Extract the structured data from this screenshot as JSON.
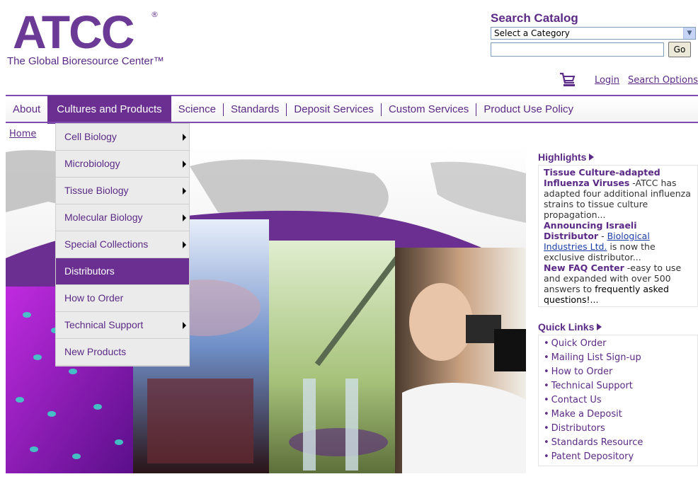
{
  "logo": {
    "mark": "ATCC",
    "reg": "®",
    "tagline": "The Global Bioresource Center™"
  },
  "search": {
    "title": "Search Catalog",
    "category_selected": "Select a Category",
    "input_value": "",
    "go_label": "Go"
  },
  "user_links": {
    "login": "Login",
    "search_options": "Search Options"
  },
  "nav": {
    "items": [
      "About",
      "Cultures and Products",
      "Science",
      "Standards",
      "Deposit Services",
      "Custom Services",
      "Product Use Policy"
    ]
  },
  "breadcrumb": {
    "home": "Home"
  },
  "dropdown": {
    "items": [
      {
        "label": "Cell Biology"
      },
      {
        "label": "Microbiology"
      },
      {
        "label": "Tissue Biology"
      },
      {
        "label": "Molecular Biology"
      },
      {
        "label": "Special Collections"
      },
      {
        "label": "Distributors"
      },
      {
        "label": "How to Order"
      },
      {
        "label": "Technical Support"
      },
      {
        "label": "New Products"
      }
    ]
  },
  "highlights": {
    "title": "Highlights",
    "item1_title": "Tissue Culture-adapted Influenza Viruses",
    "item1_text": " -ATCC has adapted four additional influenza strains to tissue culture propagation...",
    "item2_title": "Announcing Israeli Distributor",
    "item2_dash": " - ",
    "item2_link": "Biological Industries Ltd.",
    "item2_text": " is now the exclusive distributor...",
    "item3_title": "New FAQ Center",
    "item3_text": " -easy to use and expanded with over 500 answers to ",
    "item3_link": "frequently asked questions!...",
    "item3_tail": ""
  },
  "quick_links": {
    "title": "Quick Links",
    "items": [
      "Quick Order",
      "Mailing List Sign-up",
      "How to Order",
      "Technical Support",
      "Contact Us",
      "Make a Deposit",
      "Distributors",
      "Standards Resource",
      "Patent Depository"
    ]
  },
  "colors": {
    "brand_purple": "#6b2e91",
    "link_blue": "#1b3ea8"
  }
}
